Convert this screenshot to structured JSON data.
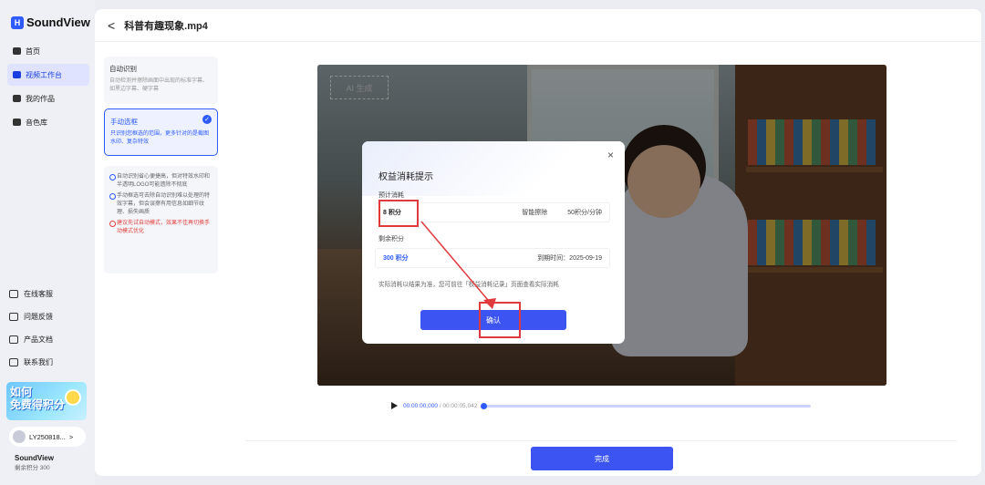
{
  "app": {
    "name": "SoundView",
    "logo_mark": "H"
  },
  "nav": [
    {
      "label": "首页",
      "icon": "home-icon"
    },
    {
      "label": "视频工作台",
      "icon": "video-icon",
      "active": true
    },
    {
      "label": "我的作品",
      "icon": "works-icon"
    },
    {
      "label": "音色库",
      "icon": "voice-library-icon"
    }
  ],
  "bottom_nav": [
    {
      "label": "在线客服",
      "icon": "headset-icon"
    },
    {
      "label": "问题反馈",
      "icon": "feedback-icon"
    },
    {
      "label": "产品文档",
      "icon": "doc-icon"
    },
    {
      "label": "联系我们",
      "icon": "qrcode-icon"
    }
  ],
  "promo": {
    "line1": "如何",
    "line2": "免费得积分"
  },
  "user": {
    "id": "LY250818...",
    "arrow": ">"
  },
  "account": {
    "name": "SoundView",
    "credits": "剩余积分 300"
  },
  "topbar": {
    "back": "<",
    "filename": "科普有趣现象.mp4"
  },
  "options": {
    "auto": {
      "title": "自动识别",
      "desc": "自动检测并擦除画面中出现的标准字幕、如黑边字幕、硬字幕"
    },
    "manual": {
      "title": "手动选框",
      "desc": "只识别您框选的范围，更多针对的是截图水印、复杂特效",
      "check": "✓"
    }
  },
  "tips": [
    {
      "text": "自动识别省心便捷高，但对特效水印和半透明LOGO可能遗除不彻底",
      "warn": false
    },
    {
      "text": "手动框选可去除自动识别难以处理的特效字幕，但会误擦有用信息如细节纹理、损失画质",
      "warn": false
    },
    {
      "text": "建议先试自动模式，效果不佳再切换手动模式优化",
      "warn": true
    }
  ],
  "video": {
    "ai_badge": "AI 生成"
  },
  "modal": {
    "title": "权益消耗提示",
    "close": "×",
    "estimate_label": "预计消耗",
    "estimate_value": "8 积分",
    "estimate_feature": "智能擦除",
    "estimate_rate": "50积分/分钟",
    "remain_label": "剩余积分",
    "remain_value": "300 积分",
    "remain_expiry": "到期时间：2025-09-19",
    "note": "实际消耗以结果为准，您可前往「权益消耗记录」页面查看实际消耗",
    "confirm": "确认"
  },
  "player": {
    "current": "00:00:00,000",
    "sep": " / ",
    "total": "00:00:05,042",
    "progress": 0
  },
  "footer": {
    "done": "完成"
  },
  "colors": {
    "accent": "#3b54f2",
    "highlight": "#e0393e"
  }
}
